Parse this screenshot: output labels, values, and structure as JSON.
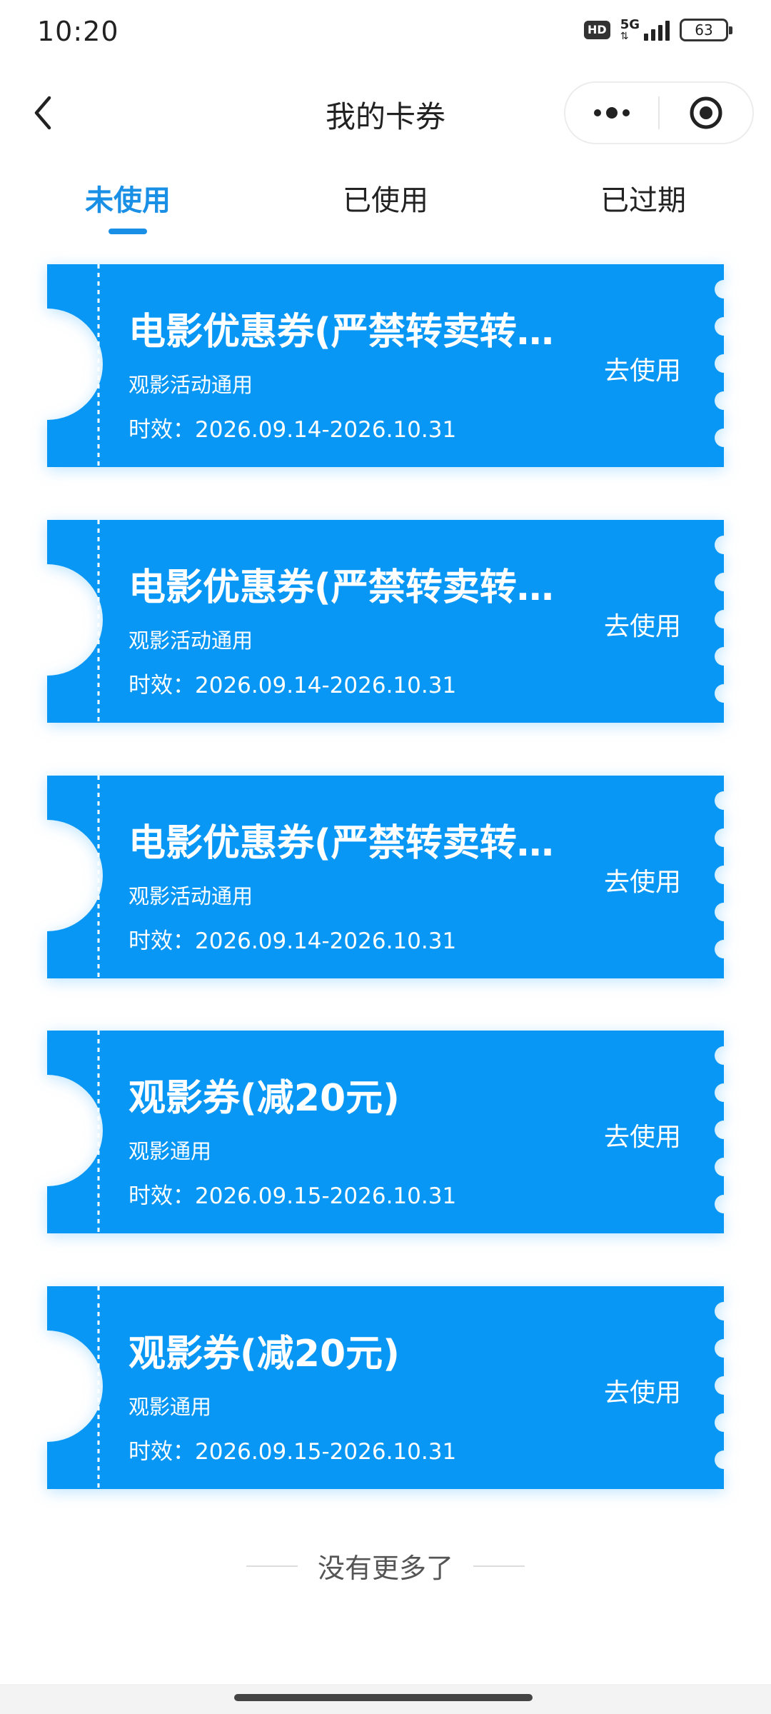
{
  "status_bar": {
    "time": "10:20",
    "hd": "HD",
    "network": "5G",
    "battery": "63"
  },
  "header": {
    "title": "我的卡券",
    "back_icon": "chevron-left-icon",
    "more_icon": "more-dots-icon",
    "close_icon": "target-circle-icon"
  },
  "tabs": [
    {
      "label": "未使用",
      "active": true
    },
    {
      "label": "已使用",
      "active": false
    },
    {
      "label": "已过期",
      "active": false
    }
  ],
  "coupons": [
    {
      "title": "电影优惠券(严禁转卖转…",
      "subtitle": "观影活动通用",
      "validity": "时效：2026.09.14-2026.10.31",
      "action": "去使用"
    },
    {
      "title": "电影优惠券(严禁转卖转…",
      "subtitle": "观影活动通用",
      "validity": "时效：2026.09.14-2026.10.31",
      "action": "去使用"
    },
    {
      "title": "电影优惠券(严禁转卖转…",
      "subtitle": "观影活动通用",
      "validity": "时效：2026.09.14-2026.10.31",
      "action": "去使用"
    },
    {
      "title": "观影券(减20元)",
      "subtitle": "观影通用",
      "validity": "时效：2026.09.15-2026.10.31",
      "action": "去使用"
    },
    {
      "title": "观影券(减20元)",
      "subtitle": "观影通用",
      "validity": "时效：2026.09.15-2026.10.31",
      "action": "去使用"
    }
  ],
  "footer": {
    "end_text": "没有更多了"
  },
  "colors": {
    "accent": "#1a8fe6",
    "coupon": "#0897f5"
  }
}
